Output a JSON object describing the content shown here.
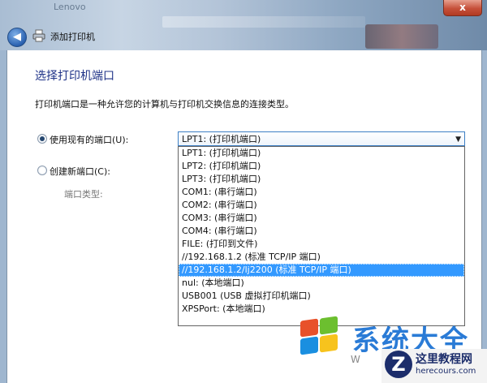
{
  "titlebar": {
    "ghost_title": "Lenovo",
    "close_glyph": "x",
    "back_glyph": "◀"
  },
  "window": {
    "title": "添加打印机"
  },
  "page": {
    "heading": "选择打印机端口",
    "description": "打印机端口是一种允许您的计算机与打印机交换信息的连接类型。"
  },
  "options": {
    "use_existing_label": "使用现有的端口(U):",
    "create_new_label": "创建新端口(C):",
    "port_type_label": "端口类型:"
  },
  "combo": {
    "selected": "LPT1: (打印机端口)",
    "arrow_glyph": "▼"
  },
  "dropdown": {
    "items": [
      "LPT1: (打印机端口)",
      "LPT2: (打印机端口)",
      "LPT3: (打印机端口)",
      "COM1: (串行端口)",
      "COM2: (串行端口)",
      "COM3: (串行端口)",
      "COM4: (串行端口)",
      "FILE: (打印到文件)",
      "//192.168.1.2 (标准 TCP/IP 端口)",
      "//192.168.1.2/lj2200 (标准 TCP/IP 端口)",
      "nul: (本地端口)",
      "USB001 (USB 虚拟打印机端口)",
      "XPSPort: (本地端口)"
    ],
    "highlighted_index": 9
  },
  "watermark": {
    "text": "系统大全",
    "sub": "W",
    "site_letter": "Z",
    "site_name": "这里教程网",
    "site_url": "herecours.com"
  },
  "colors": {
    "heading": "#1e3287",
    "selection": "#3399ff"
  },
  "icons": [
    "back-arrow-icon",
    "printer-icon",
    "close-icon",
    "radio-selected",
    "windows-flag-icon"
  ]
}
